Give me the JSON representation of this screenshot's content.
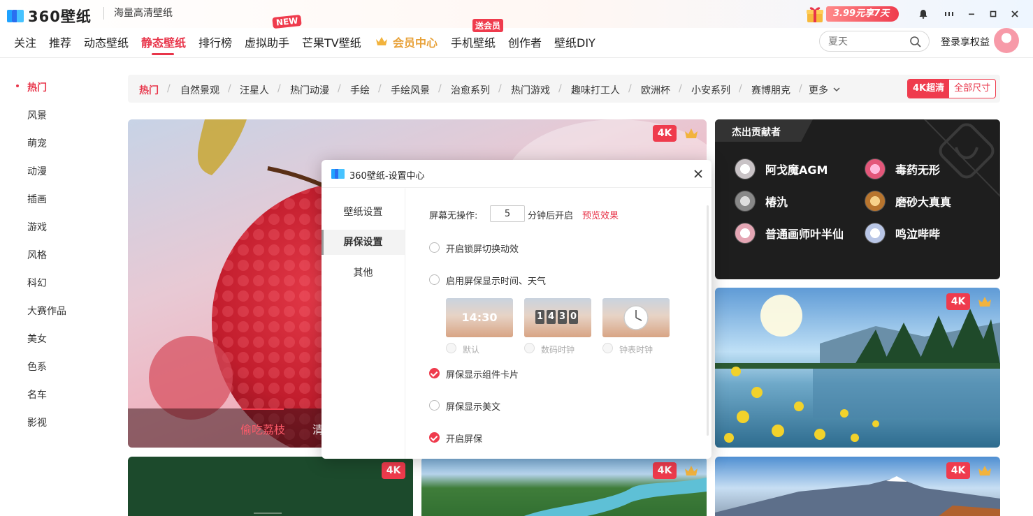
{
  "app": {
    "logo_text": "360壁纸",
    "slogan": "海量高清壁纸",
    "promo": "3.99元享7天"
  },
  "nav": {
    "items": [
      "关注",
      "推荐",
      "动态壁纸",
      "静态壁纸",
      "排行榜",
      "虚拟助手",
      "芒果TV壁纸",
      "会员中心",
      "手机壁纸",
      "创作者",
      "壁纸DIY"
    ],
    "active": "静态壁纸",
    "badge_new": "NEW",
    "badge_vip": "送会员",
    "search_placeholder": "夏天",
    "login": "登录享权益"
  },
  "sidebar": {
    "items": [
      "热门",
      "风景",
      "萌宠",
      "动漫",
      "插画",
      "游戏",
      "风格",
      "科幻",
      "大赛作品",
      "美女",
      "色系",
      "名车",
      "影视"
    ],
    "active": "热门"
  },
  "categories": {
    "items": [
      "热门",
      "自然景观",
      "汪星人",
      "热门动漫",
      "手绘",
      "手绘风景",
      "治愈系列",
      "热门游戏",
      "趣味打工人",
      "欧洲杯",
      "小安系列",
      "赛博朋克",
      "更多"
    ],
    "active": "热门",
    "toggle_on": "4K超清",
    "toggle_off": "全部尺寸"
  },
  "cards": {
    "quality_badge": "4K",
    "featured_title": "偷吃荔枝",
    "featured_title_next": "清"
  },
  "contributors": {
    "title": "杰出贡献者",
    "names": [
      "阿戈魔AGM",
      "毒药无形",
      "椿氿",
      "磨砂大真真",
      "普通画师叶半仙",
      "鸣泣哔哔"
    ]
  },
  "dialog": {
    "title": "360壁纸-设置中心",
    "tabs": [
      "壁纸设置",
      "屏保设置",
      "其他"
    ],
    "active_tab": "屏保设置",
    "idle_label": "屏幕无操作:",
    "idle_minutes": "5",
    "idle_suffix": "分钟后开启",
    "preview_link": "预览效果",
    "options": {
      "lock_switch": {
        "label": "开启锁屏切换动效",
        "checked": false
      },
      "show_time_weather": {
        "label": "启用屏保显示时间、天气",
        "checked": false
      },
      "widget_cards": {
        "label": "屏保显示组件卡片",
        "checked": true
      },
      "show_prose": {
        "label": "屏保显示美文",
        "checked": false
      },
      "enable_saver": {
        "label": "开启屏保",
        "checked": true
      }
    },
    "clock_styles": [
      {
        "label": "默认",
        "preview": "14:30"
      },
      {
        "label": "数码时钟",
        "preview": "1430"
      },
      {
        "label": "钟表时钟",
        "preview": ""
      }
    ]
  },
  "colors": {
    "accent": "#ef3b4d",
    "dark_panel": "#1e1e1e"
  }
}
